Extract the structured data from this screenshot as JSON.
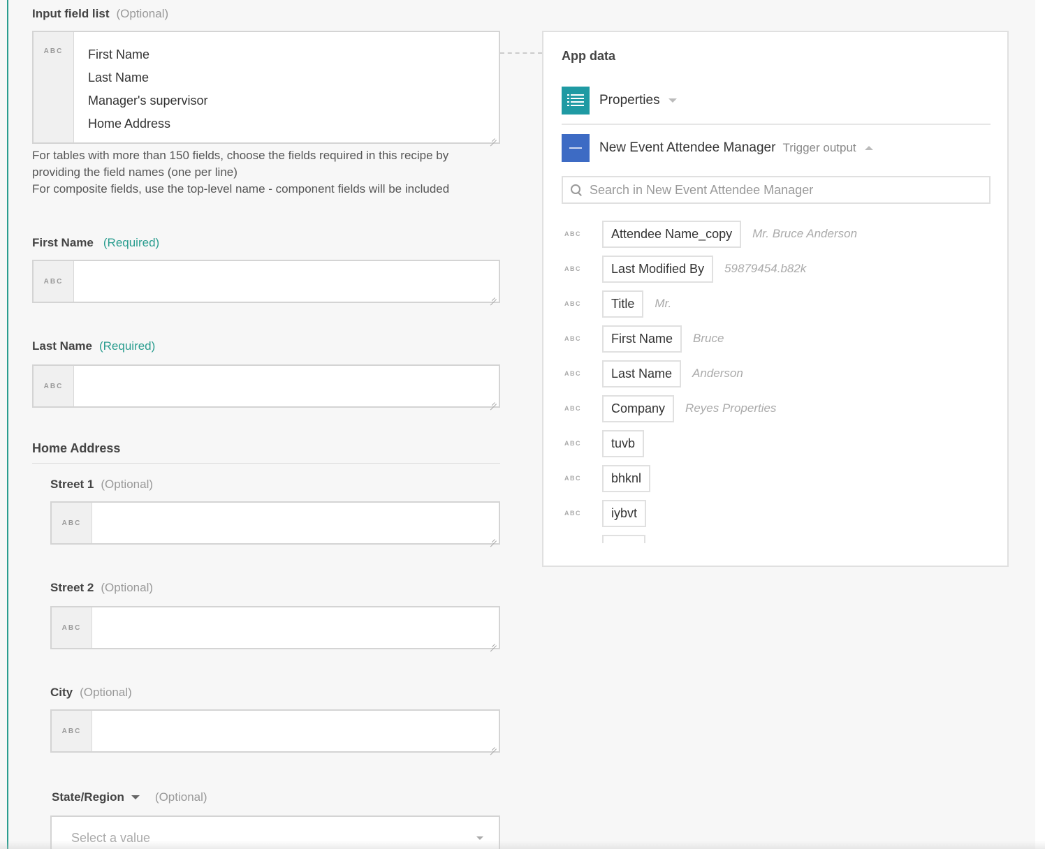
{
  "input_field_list": {
    "label": "Input field list",
    "optional": "(Optional)",
    "badge": "ABC",
    "lines": [
      "First Name",
      "Last Name",
      "Manager's supervisor",
      "Home Address"
    ],
    "help_1": "For tables with more than 150 fields, choose the fields required in this recipe by providing the field names (one per line)",
    "help_2": "For composite fields, use the top-level name - component fields will be included"
  },
  "first_name": {
    "label": "First Name",
    "required": "(Required)",
    "badge": "ABC"
  },
  "last_name": {
    "label": "Last Name",
    "required": "(Required)",
    "badge": "ABC"
  },
  "home_address": {
    "title": "Home Address",
    "street1": {
      "label": "Street 1",
      "optional": "(Optional)",
      "badge": "ABC"
    },
    "street2": {
      "label": "Street 2",
      "optional": "(Optional)",
      "badge": "ABC"
    },
    "city": {
      "label": "City",
      "optional": "(Optional)",
      "badge": "ABC"
    },
    "state": {
      "label": "State/Region",
      "optional": "(Optional)",
      "placeholder": "Select a value"
    }
  },
  "app_data": {
    "title": "App data",
    "properties": "Properties",
    "app_name": "New Event Attendee Manager",
    "app_sub": "Trigger output",
    "search_placeholder": "Search in New Event Attendee Manager",
    "badge": "ABC",
    "pills": [
      {
        "name": "Attendee Name_copy",
        "value": "Mr. Bruce Anderson"
      },
      {
        "name": "Last Modified By",
        "value": "59879454.b82k"
      },
      {
        "name": "Title",
        "value": "Mr."
      },
      {
        "name": "First Name",
        "value": "Bruce"
      },
      {
        "name": "Last Name",
        "value": "Anderson"
      },
      {
        "name": "Company",
        "value": "Reyes Properties"
      },
      {
        "name": "tuvb",
        "value": ""
      },
      {
        "name": "bhknl",
        "value": ""
      },
      {
        "name": "iybvt",
        "value": ""
      }
    ]
  },
  "colors": {
    "accent": "#2a9d8f",
    "app_icon_teal": "#1f9aa3",
    "app_icon_blue": "#3d6bc4"
  },
  "icons": {
    "properties": "list-icon",
    "app": "app-logo-icon",
    "search": "search-icon"
  }
}
